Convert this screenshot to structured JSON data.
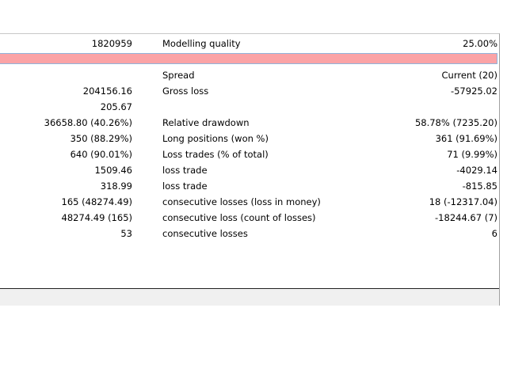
{
  "report": {
    "rows": [
      {
        "value1": "1820959",
        "label": "Modelling quality",
        "value2": "25.00%"
      },
      {
        "value1": "",
        "label": "Spread",
        "value2": "Current (20)"
      },
      {
        "value1": "204156.16",
        "label": "Gross loss",
        "value2": "-57925.02"
      },
      {
        "value1": "205.67",
        "label": "",
        "value2": ""
      },
      {
        "value1": "36658.80 (40.26%)",
        "label": "Relative drawdown",
        "value2": "58.78% (7235.20)"
      },
      {
        "value1": "350 (88.29%)",
        "label": "Long positions (won %)",
        "value2": "361 (91.69%)"
      },
      {
        "value1": "640 (90.01%)",
        "label": "Loss trades (% of total)",
        "value2": "71 (9.99%)"
      },
      {
        "value1": "1509.46",
        "label": "loss trade",
        "value2": "-4029.14"
      },
      {
        "value1": "318.99",
        "label": "loss trade",
        "value2": "-815.85"
      },
      {
        "value1": "165 (48274.49)",
        "label": "consecutive losses (loss in money)",
        "value2": "18 (-12317.04)"
      },
      {
        "value1": "48274.49 (165)",
        "label": "consecutive loss (count of losses)",
        "value2": "-18244.67 (7)"
      },
      {
        "value1": "53",
        "label": "consecutive losses",
        "value2": "6"
      }
    ]
  },
  "colors": {
    "highlight": "#ffff00",
    "error_bar": "#fba3a6",
    "panel": "#f0f0f0"
  }
}
